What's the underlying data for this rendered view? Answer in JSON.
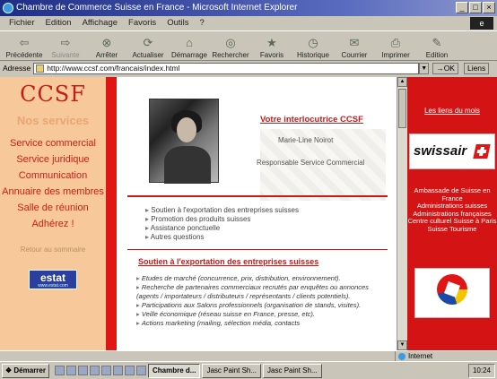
{
  "window": {
    "title": "Chambre de Commerce Suisse en France - Microsoft Internet Explorer",
    "controls": [
      "_",
      "□",
      "×"
    ]
  },
  "menubar": {
    "items": [
      "Fichier",
      "Edition",
      "Affichage",
      "Favoris",
      "Outils",
      "?"
    ]
  },
  "toolbar": {
    "buttons": [
      {
        "label": "Précédente",
        "icon": "back-arrow-icon",
        "glyph": "⇦"
      },
      {
        "label": "Suivante",
        "icon": "forward-arrow-icon",
        "glyph": "⇨",
        "disabled": true
      },
      {
        "label": "Arrêter",
        "icon": "stop-icon",
        "glyph": "⊗"
      },
      {
        "label": "Actualiser",
        "icon": "refresh-icon",
        "glyph": "⟳"
      },
      {
        "label": "Démarrage",
        "icon": "home-icon",
        "glyph": "⌂"
      },
      {
        "label": "Rechercher",
        "icon": "search-icon",
        "glyph": "◎"
      },
      {
        "label": "Favoris",
        "icon": "favorites-icon",
        "glyph": "★"
      },
      {
        "label": "Historique",
        "icon": "history-icon",
        "glyph": "◷"
      },
      {
        "label": "Courrier",
        "icon": "mail-icon",
        "glyph": "✉"
      },
      {
        "label": "Imprimer",
        "icon": "print-icon",
        "glyph": "⎙"
      },
      {
        "label": "Edition",
        "icon": "edit-icon",
        "glyph": "✎"
      }
    ]
  },
  "addressbar": {
    "label": "Adresse",
    "url": "http://www.ccsf.com/francais/index.html",
    "go_label": "OK",
    "links_label": "Liens"
  },
  "sidebar": {
    "logo": "CCSF",
    "title": "Nos services",
    "items": [
      "Service commercial",
      "Service juridique",
      "Communication",
      "Annuaire des membres",
      "Salle de réunion",
      "Adhérez !"
    ],
    "back_link": "Retour au sommaire",
    "estat_label": "estat"
  },
  "main": {
    "contact_title": "Votre interlocutrice CCSF",
    "contact_name": "Marie-Line Noirot",
    "contact_role": "Responsable Service Commercial",
    "bullets": [
      "Soutien à l'exportation des entreprises suisses",
      "Promotion des produits suisses",
      "Assistance ponctuelle",
      "Autres questions"
    ],
    "section_title": "Soutien à l'exportation des entreprises suisses",
    "details": [
      "Etudes de marché (concurrence, prix, distribution, environnement).",
      "Recherche de partenaires commerciaux recrutés par enquêtes ou annonces (agents / importateurs / distributeurs / représentants / clients potentiels).",
      "Participations aux Salons professionnels (organisation de stands, visites).",
      "Veille économique (réseau suisse en France, presse, etc).",
      "Actions marketing (mailing, sélection média, contacts"
    ]
  },
  "right": {
    "links_title": "Les liens du mois",
    "swissair": "swissair",
    "links": [
      "Ambassade de Suisse en France",
      "Administrations suisses",
      "Administrations françaises",
      "Centre culturel Suisse à Paris",
      "Suisse Tourisme"
    ]
  },
  "statusbar": {
    "text": "",
    "zone": "Internet"
  },
  "taskbar": {
    "start": "Démarrer",
    "tasks": [
      {
        "label": "Chambre d...",
        "active": true
      },
      {
        "label": "Jasc Paint Sh..."
      },
      {
        "label": "Jasc Paint Sh..."
      }
    ],
    "clock": "10:24"
  },
  "colors": {
    "brand_red": "#c41b1b",
    "sidebar_bg": "#f7c89a",
    "right_bg": "#d41414",
    "title_bar": "#1e2e86"
  }
}
